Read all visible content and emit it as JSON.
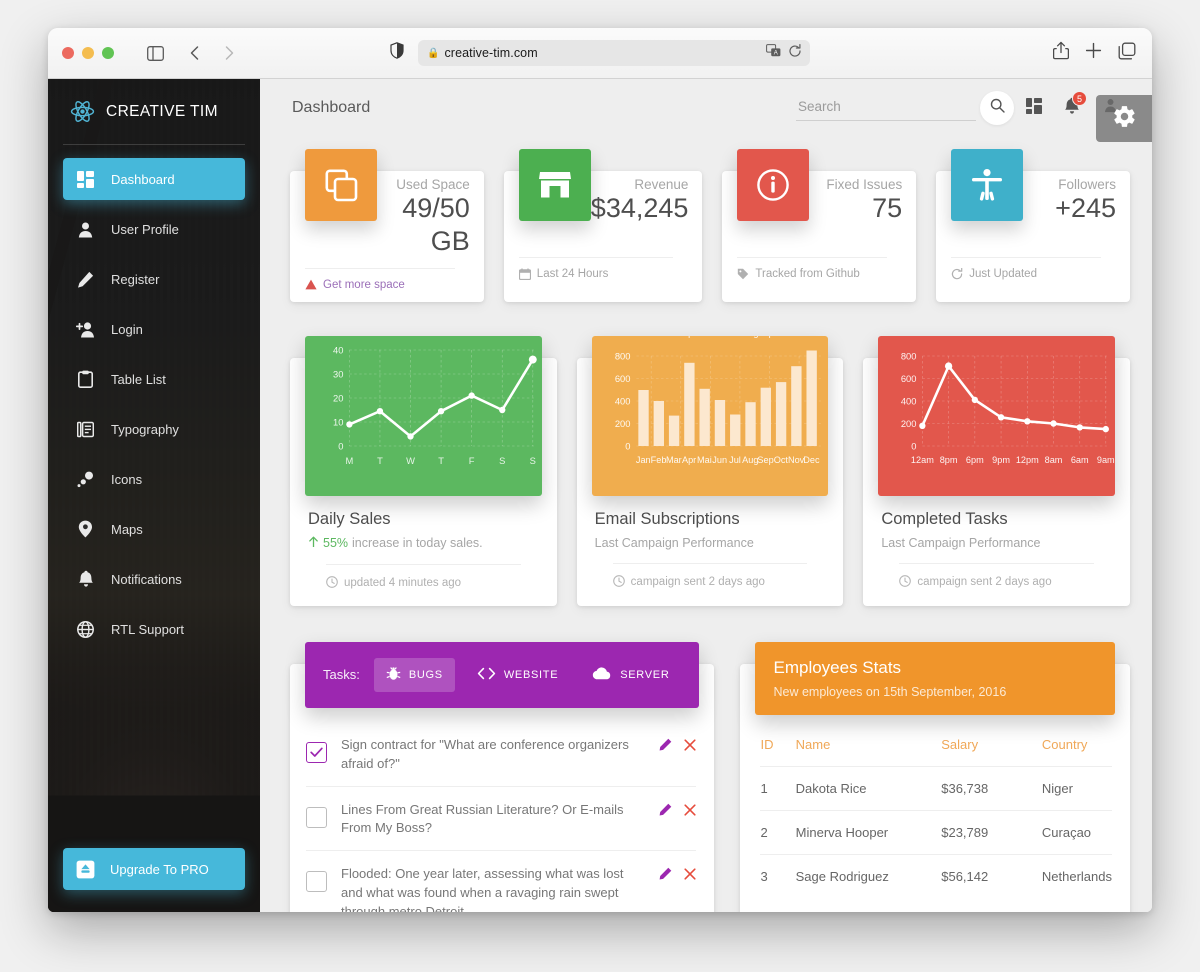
{
  "browser": {
    "url": "creative-tim.com",
    "lock_icon": "lock-icon",
    "back_icon": "chevron-left-icon",
    "forward_icon": "chevron-right-icon",
    "sidebar_icon": "sidebar-toggle-icon",
    "shield_icon": "shield-icon",
    "translate_icon": "translate-icon",
    "reload_icon": "reload-icon",
    "share_icon": "share-icon",
    "newtab_icon": "plus-icon",
    "tabs_icon": "tabs-overview-icon"
  },
  "sidebar": {
    "brand": "CREATIVE TIM",
    "brand_logo_icon": "react-atom-icon",
    "items": [
      {
        "label": "Dashboard",
        "icon": "dashboard-grid-icon",
        "active": true
      },
      {
        "label": "User Profile",
        "icon": "person-icon",
        "active": false
      },
      {
        "label": "Register",
        "icon": "pencil-icon",
        "active": false
      },
      {
        "label": "Login",
        "icon": "person-add-icon",
        "active": false
      },
      {
        "label": "Table List",
        "icon": "clipboard-icon",
        "active": false
      },
      {
        "label": "Typography",
        "icon": "typography-icon",
        "active": false
      },
      {
        "label": "Icons",
        "icon": "bubbles-icon",
        "active": false
      },
      {
        "label": "Maps",
        "icon": "map-pin-icon",
        "active": false
      },
      {
        "label": "Notifications",
        "icon": "bell-icon",
        "active": false
      },
      {
        "label": "RTL Support",
        "icon": "globe-icon",
        "active": false
      }
    ],
    "upgrade": {
      "label": "Upgrade To PRO",
      "icon": "upload-box-icon"
    }
  },
  "topbar": {
    "title": "Dashboard",
    "search_placeholder": "Search",
    "search_value": "",
    "search_icon": "search-icon",
    "apps_icon": "apps-grid-icon",
    "notifications_icon": "bell-icon",
    "notifications_count": "5",
    "person_icon": "person-icon"
  },
  "settings_fab": {
    "icon": "gear-icon"
  },
  "stats": [
    {
      "label": "Used Space",
      "value": "49/50",
      "value2": "GB",
      "footer": "Get more space",
      "footer_icon": "warning-triangle-icon",
      "footer_warn": true,
      "icon": "copy-icon",
      "color": "#ef9a3d"
    },
    {
      "label": "Revenue",
      "value": "$34,245",
      "value2": "",
      "footer": "Last 24 Hours",
      "footer_icon": "calendar-icon",
      "footer_warn": false,
      "icon": "store-icon",
      "color": "#4caf50"
    },
    {
      "label": "Fixed Issues",
      "value": "75",
      "value2": "",
      "footer": "Tracked from Github",
      "footer_icon": "tag-icon",
      "footer_warn": false,
      "icon": "info-circle-icon",
      "color": "#e2574c"
    },
    {
      "label": "Followers",
      "value": "+245",
      "value2": "",
      "footer": "Just Updated",
      "footer_icon": "refresh-icon",
      "footer_warn": false,
      "icon": "accessibility-icon",
      "color": "#3fb0ca"
    }
  ],
  "charts": [
    {
      "title": "Daily Sales",
      "subtitle_prefix": "55%",
      "subtitle": "increase in today sales.",
      "subtitle_trend_icon": "arrow-up-icon",
      "footer": "updated 4 minutes ago",
      "footer_icon": "clock-icon",
      "bg": "#5cb860"
    },
    {
      "title": "Email Subscriptions",
      "subtitle_prefix": "",
      "subtitle": "Last Campaign Performance",
      "subtitle_trend_icon": "",
      "footer": "campaign sent 2 days ago",
      "footer_icon": "clock-icon",
      "bg": "#f0ad4e"
    },
    {
      "title": "Completed Tasks",
      "subtitle_prefix": "",
      "subtitle": "Last Campaign Performance",
      "subtitle_trend_icon": "",
      "footer": "campaign sent 2 days ago",
      "footer_icon": "clock-icon",
      "bg": "#e2574c"
    }
  ],
  "chart_data": [
    {
      "type": "line",
      "title": "Daily Sales",
      "categories": [
        "M",
        "T",
        "W",
        "T",
        "F",
        "S",
        "S"
      ],
      "values": [
        9,
        14.5,
        4,
        14.5,
        21,
        15,
        36
      ],
      "yticks": [
        0,
        10,
        20,
        30,
        40
      ],
      "ylim": [
        0,
        45
      ],
      "xlabel": "",
      "ylabel": "",
      "grid": true,
      "legend": "none",
      "series_color": "#ffffff",
      "bg_color": "#5cb860"
    },
    {
      "type": "bar",
      "title": "Email Subscriptions",
      "categories": [
        "Jan",
        "Feb",
        "Mar",
        "Apr",
        "Mai",
        "Jun",
        "Jul",
        "Aug",
        "Sep",
        "Oct",
        "Nov",
        "Dec"
      ],
      "values": [
        500,
        400,
        270,
        740,
        510,
        410,
        280,
        390,
        520,
        570,
        710,
        850
      ],
      "yticks": [
        0,
        200,
        400,
        600,
        800
      ],
      "ylim": [
        0,
        900
      ],
      "xlabel": "",
      "ylabel": "",
      "grid": true,
      "legend": "none",
      "series_color": "#fce8cf",
      "bg_color": "#f0ad4e"
    },
    {
      "type": "line",
      "title": "Completed Tasks",
      "categories": [
        "12am",
        "8pm",
        "6pm",
        "9pm",
        "12pm",
        "8am",
        "6am",
        "9am"
      ],
      "values": [
        180,
        710,
        410,
        255,
        220,
        200,
        165,
        150
      ],
      "yticks": [
        0,
        200,
        400,
        600,
        800
      ],
      "ylim": [
        0,
        900
      ],
      "xlabel": "",
      "ylabel": "",
      "grid": true,
      "legend": "none",
      "series_color": "#ffffff",
      "bg_color": "#e2574c"
    }
  ],
  "tasks": {
    "label": "Tasks:",
    "tabs": [
      {
        "label": "BUGS",
        "icon": "bug-icon",
        "active": true
      },
      {
        "label": "WEBSITE",
        "icon": "code-icon",
        "active": false
      },
      {
        "label": "SERVER",
        "icon": "cloud-icon",
        "active": false
      }
    ],
    "items": [
      {
        "text": "Sign contract for \"What are conference organizers afraid of?\"",
        "checked": true
      },
      {
        "text": "Lines From Great Russian Literature? Or E-mails From My Boss?",
        "checked": false
      },
      {
        "text": "Flooded: One year later, assessing what was lost and what was found when a ravaging rain swept through metro Detroit",
        "checked": false
      }
    ],
    "edit_icon": "pencil-icon",
    "delete_icon": "close-x-icon"
  },
  "employees": {
    "title": "Employees Stats",
    "subtitle": "New employees on 15th September, 2016",
    "columns": [
      "ID",
      "Name",
      "Salary",
      "Country"
    ],
    "rows": [
      {
        "id": "1",
        "name": "Dakota Rice",
        "salary": "$36,738",
        "country": "Niger"
      },
      {
        "id": "2",
        "name": "Minerva Hooper",
        "salary": "$23,789",
        "country": "Curaçao"
      },
      {
        "id": "3",
        "name": "Sage Rodriguez",
        "salary": "$56,142",
        "country": "Netherlands"
      }
    ]
  }
}
